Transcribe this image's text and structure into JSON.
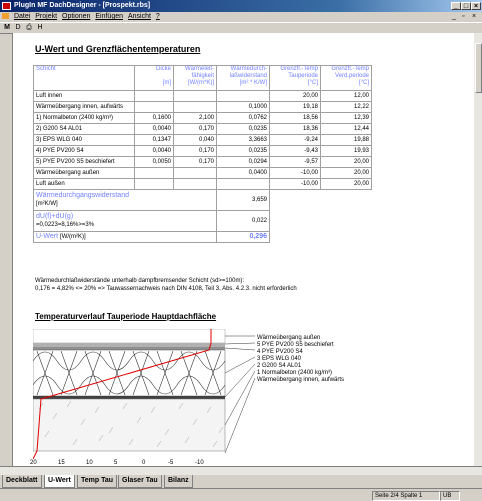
{
  "window": {
    "title": "PlugIn MF DachDesigner - [Prospekt.rbs]",
    "min": "_",
    "max": "□",
    "close": "×",
    "doc_min": "_",
    "doc_max": "▫",
    "doc_close": "×"
  },
  "menu": [
    "Datei",
    "Projekt",
    "Optionen",
    "Einfügen",
    "Ansicht",
    "?"
  ],
  "toolbar": {
    "t1": "M",
    "t2": "D",
    "t3": "⎙",
    "t4": "H"
  },
  "doc": {
    "title": "U-Wert und Grenzflächentemperaturen",
    "table": {
      "headers": [
        "Schicht",
        "Dicke",
        "Wärmeleit-\nfähigkeit",
        "Wärmedurch-\nlaßwiderstand",
        "Grenzfl.-Temp\nTauperiode",
        "Grenzfl.-Temp\nVerd.periode"
      ],
      "units": [
        "",
        "[m]",
        "[W/(m*K)]",
        "[m² * K/W]",
        "[°C]",
        "[°C]"
      ],
      "rows": [
        [
          "Luft innen",
          "",
          "",
          "",
          "20,00",
          "12,00"
        ],
        [
          "Wärmeübergang innen, aufwärts",
          "",
          "",
          "0,1000",
          "19,18",
          "12,22"
        ],
        [
          "1) Normalbeton (2400 kg/m³)",
          "0,1600",
          "2,100",
          "0,0762",
          "18,56",
          "12,39"
        ],
        [
          "2) G200 S4 AL01",
          "0,0040",
          "0,170",
          "0,0235",
          "18,36",
          "12,44"
        ],
        [
          "3) EPS WLG 040",
          "0,1347",
          "0,040",
          "3,3663",
          "-9,24",
          "19,88"
        ],
        [
          "4) PYE PV200 S4",
          "0,0040",
          "0,170",
          "0,0235",
          "-9,43",
          "19,93"
        ],
        [
          "5) PYE PV200 S5 beschiefert",
          "0,0050",
          "0,170",
          "0,0294",
          "-9,57",
          "20,00"
        ],
        [
          "Wärmeübergang außen",
          "",
          "",
          "0,0400",
          "-10,00",
          "20,00"
        ],
        [
          "Luft außen",
          "",
          "",
          "",
          "-10,00",
          "20,00"
        ]
      ],
      "resistance_label": "Wärmedurchgangswiderstand",
      "resistance_unit": "[m²K/W]",
      "resistance_value": "3,659",
      "dU_label": "dU(f)+dU(g)",
      "dU_sub": "=0,0223=8,16%>=3%",
      "dU_value": "0,022",
      "u_label": "U-Wert",
      "u_unit": "[W/(m²K)]",
      "u_value": "0,296"
    },
    "note_line1": "Wärmedurchlaßwiderstände unterhalb dampfbremsender Schicht (sd>=100m):",
    "note_line2": "0,176 = 4,82% <= 20% => Tauwassernachweis nach DIN 4108, Teil 3, Abs. 4.2.3. nicht erforderlich",
    "diagram_title": "Temperaturverlauf Tauperiode Hauptdachfläche",
    "legend": [
      "Wärmeübergang außen",
      "5 PYE PV200 S5 beschiefert",
      "4 PYE PV200 S4",
      "3 EPS WLG 040",
      "2 G200 S4 AL01",
      "1 Normalbeton (2400 kg/m³)",
      "Wärmeübergang innen, aufwärts"
    ],
    "axis_ticks": [
      "20",
      "15",
      "10",
      "5",
      "0",
      "-5",
      "-10"
    ]
  },
  "tabs": [
    "Deckblatt",
    "U-Wert",
    "Temp Tau",
    "Glaser Tau",
    "Bilanz"
  ],
  "status": {
    "position": "Seite 2/4 Spalte 1",
    "mode": "UB"
  }
}
